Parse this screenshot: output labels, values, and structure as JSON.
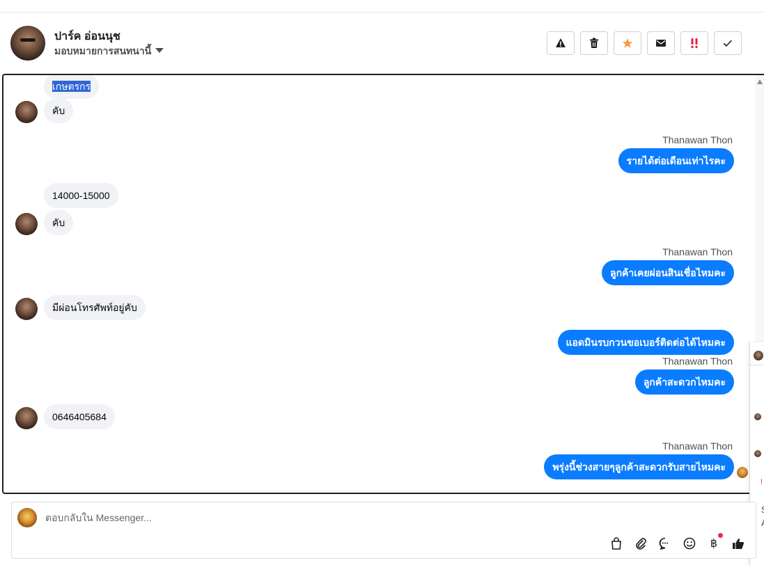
{
  "header": {
    "contact_name": "ปาร์ค อ่อนนุช",
    "assign_label": "มอบหมายการสนทนานี้",
    "actions": [
      "spam-icon",
      "trash-icon",
      "star-icon",
      "mail-icon",
      "follow-up-icon",
      "done-icon"
    ],
    "colors": {
      "star": "#f59a3e",
      "follow_up": "#e41e3f"
    }
  },
  "messages": {
    "m1": "เกษตรกร",
    "m2": "คับ",
    "s1": "Thanawan Thon",
    "m3": "รายได้ต่อเดือนเท่าไรคะ",
    "m4": "14000-15000",
    "m5": "คับ",
    "s2": "Thanawan Thon",
    "m6": "ลูกค้าเคยผ่อนสินเชื่อไหมคะ",
    "m7": "มีผ่อนโทรศัพท์อยู่คับ",
    "m8": "แอดมินรบกวนขอเบอร์ติดต่อได้ไหมคะ",
    "s3": "Thanawan Thon",
    "m9": "ลูกค้าสะดวกไหมคะ",
    "m10": "0646405684",
    "s4": "Thanawan Thon",
    "m11": "พรุ่งนี้ช่วงสายๆลูกค้าสะดวกรับสายไหมคะ"
  },
  "side_panel": {
    "char1": "S",
    "char2": "A"
  },
  "composer": {
    "placeholder": "ตอบกลับใน Messenger...",
    "tools": [
      "shopping-bag-icon",
      "attachment-icon",
      "saved-reply-icon",
      "emoji-icon",
      "baht-payment-icon",
      "thumbs-up-icon"
    ],
    "currency_symbol": "฿"
  },
  "colors": {
    "outgoing_bubble": "#0a7cff",
    "incoming_bubble": "#f0f2f5"
  }
}
